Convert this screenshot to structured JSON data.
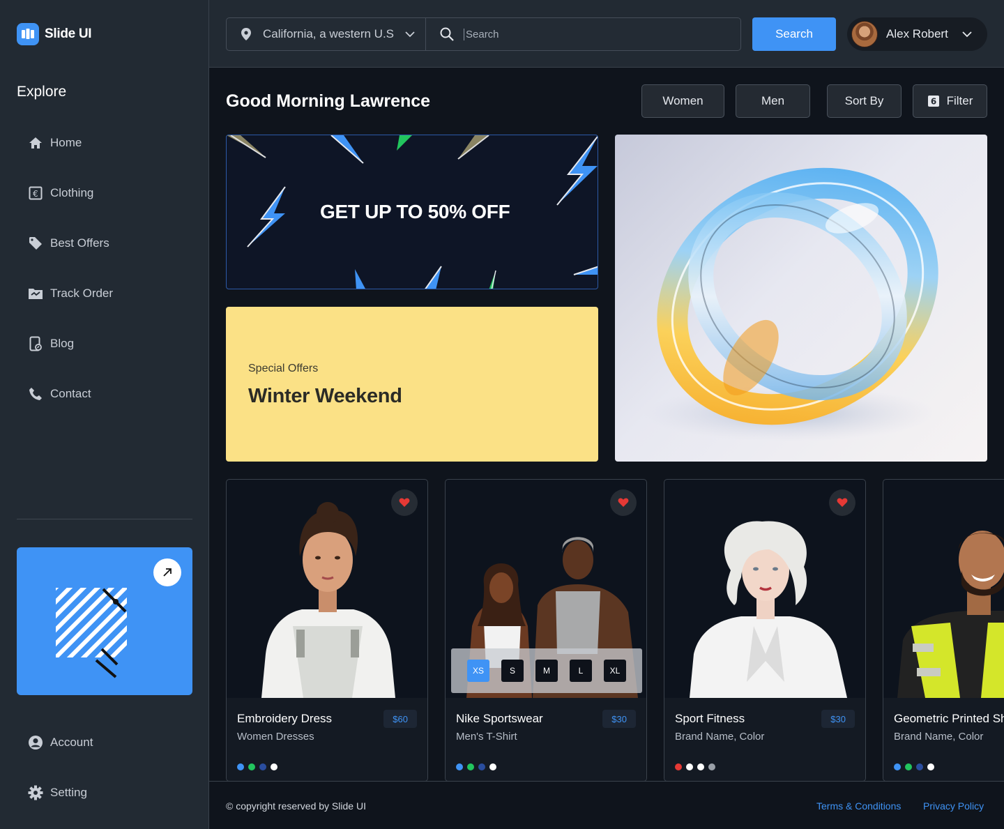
{
  "app": {
    "name": "Slide UI"
  },
  "sidebar": {
    "section_title": "Explore",
    "items": [
      {
        "label": "Home",
        "icon": "home-icon"
      },
      {
        "label": "Clothing",
        "icon": "euro-box-icon"
      },
      {
        "label": "Best Offers",
        "icon": "tag-icon"
      },
      {
        "label": "Track Order",
        "icon": "folder-track-icon"
      },
      {
        "label": "Blog",
        "icon": "tablet-blog-icon"
      },
      {
        "label": "Contact",
        "icon": "phone-icon"
      }
    ],
    "bottom_items": [
      {
        "label": "Account",
        "icon": "user-circle-icon"
      },
      {
        "label": "Setting",
        "icon": "gear-icon"
      }
    ]
  },
  "header": {
    "location": "California, a western U.S",
    "search_placeholder": "Search",
    "search_button": "Search",
    "user_name": "Alex Robert"
  },
  "main": {
    "greeting": "Good Morning Lawrence",
    "chips": {
      "women": "Women",
      "men": "Men",
      "sort": "Sort By",
      "filter": "Filter",
      "filter_icon_text": "6"
    }
  },
  "banners": {
    "sale_headline": "GET UP TO 50% OFF",
    "special_sub": "Special Offers",
    "special_title": "Winter Weekend"
  },
  "colors": {
    "accent": "#3f93f5",
    "yellow": "#fbe186",
    "heart": "#e53935"
  },
  "products": [
    {
      "name": "Embroidery Dress",
      "category": "Women Dresses",
      "price": "$60",
      "swatches": [
        "#3f93f5",
        "#22c55e",
        "#2a4d9e",
        "#ffffff"
      ]
    },
    {
      "name": "Nike Sportswear",
      "category": "Men's T-Shirt",
      "price": "$30",
      "swatches": [
        "#3f93f5",
        "#22c55e",
        "#2a4d9e",
        "#ffffff"
      ],
      "sizes": [
        "XS",
        "S",
        "M",
        "L",
        "XL"
      ],
      "selected_size": "XS"
    },
    {
      "name": "Sport Fitness",
      "category": "Brand Name, Color",
      "price": "$30",
      "swatches": [
        "#e53935",
        "#ffffff",
        "#ffffff",
        "#9aa0a8"
      ]
    },
    {
      "name": "Geometric Printed Sh",
      "category": "Brand Name, Color",
      "price": "",
      "swatches": [
        "#3f93f5",
        "#22c55e",
        "#2a4d9e",
        "#ffffff"
      ]
    }
  ],
  "footer": {
    "copyright": "© copyright reserved by Slide UI",
    "terms": "Terms & Conditions",
    "privacy": "Privacy Policy"
  }
}
